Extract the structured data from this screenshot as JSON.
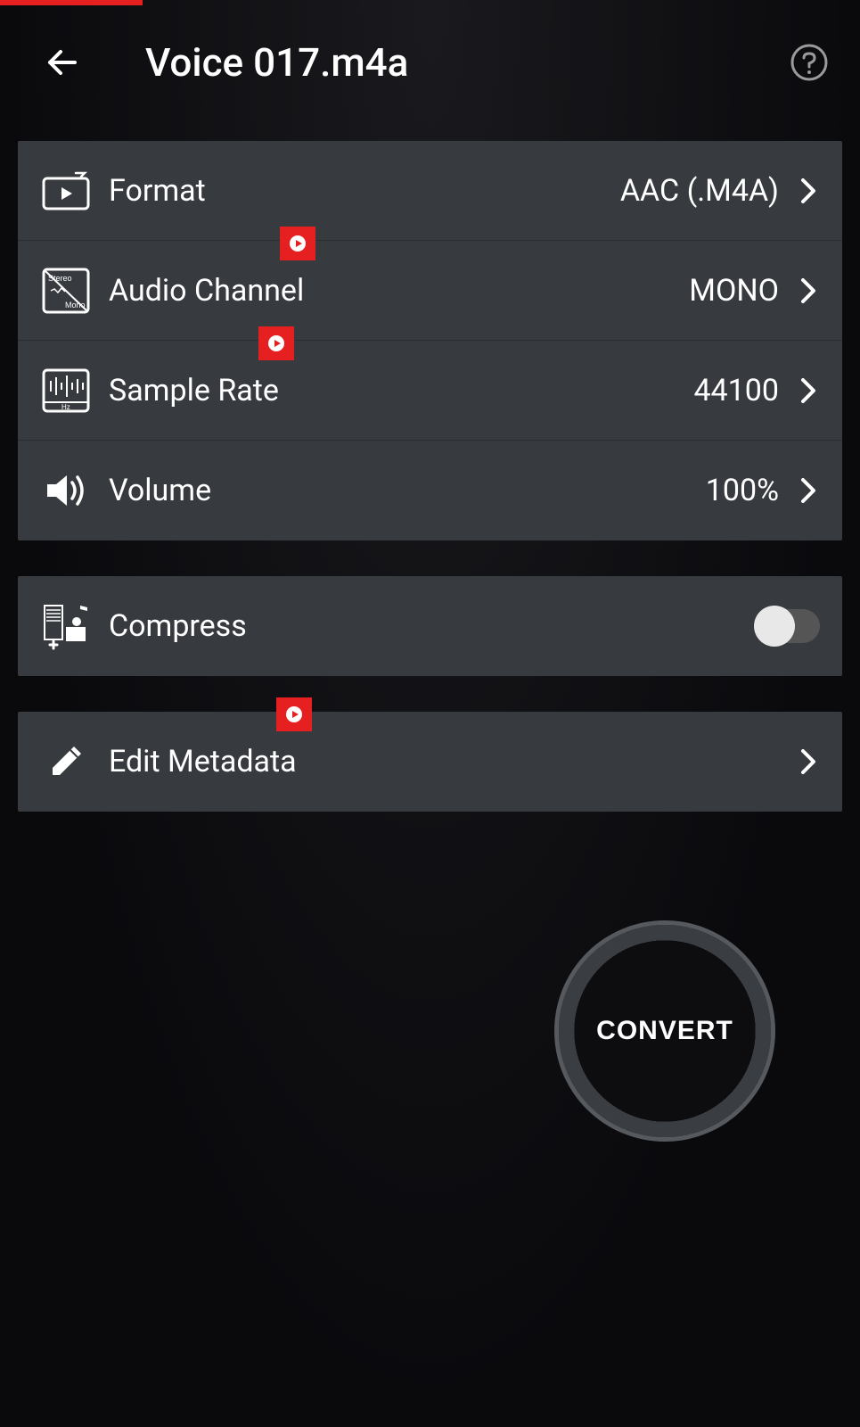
{
  "header": {
    "title": "Voice 017.m4a"
  },
  "settings": {
    "format": {
      "label": "Format",
      "value": "AAC (.M4A)"
    },
    "audioChannel": {
      "label": "Audio Channel",
      "value": "MONO"
    },
    "sampleRate": {
      "label": "Sample Rate",
      "value": "44100"
    },
    "volume": {
      "label": "Volume",
      "value": "100%"
    },
    "compress": {
      "label": "Compress",
      "enabled": false
    },
    "editMetadata": {
      "label": "Edit Metadata"
    }
  },
  "convert": {
    "label": "CONVERT"
  }
}
